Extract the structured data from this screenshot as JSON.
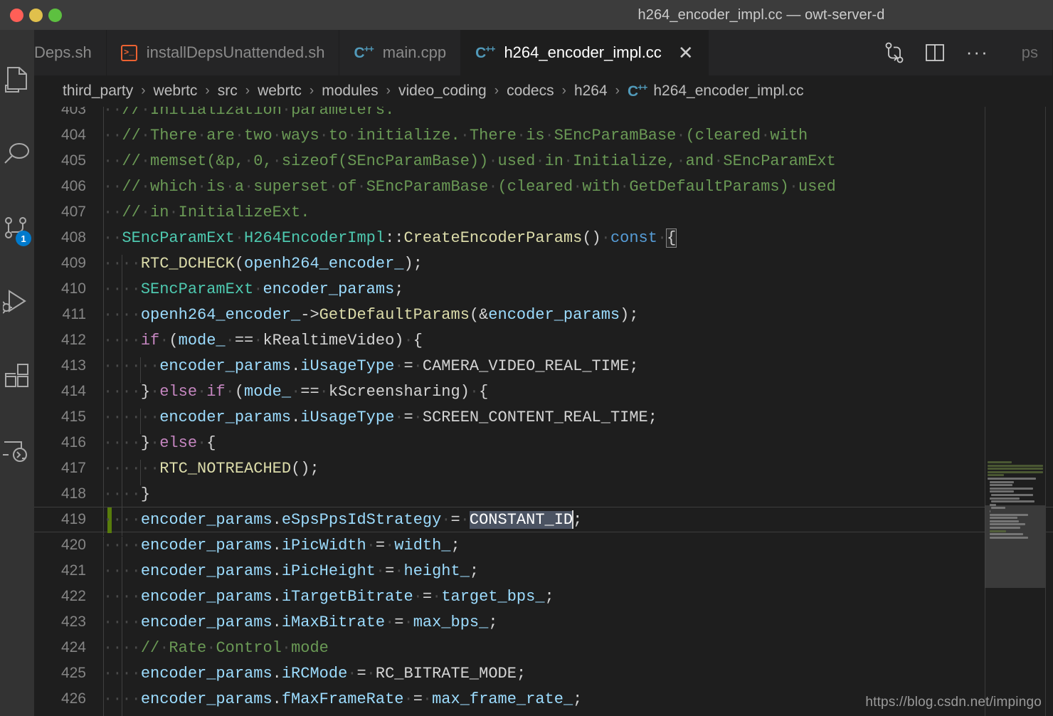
{
  "window": {
    "title": "h264_encoder_impl.cc — owt-server-d",
    "traffic_lights": [
      "close-red",
      "minimize-yellow",
      "maximize-green"
    ]
  },
  "activity_bar": {
    "items": [
      {
        "name": "explorer",
        "icon": "files-icon",
        "badge": ""
      },
      {
        "name": "search",
        "icon": "search-icon",
        "badge": ""
      },
      {
        "name": "source-control",
        "icon": "source-control-icon",
        "badge": "1"
      },
      {
        "name": "run-and-debug",
        "icon": "run-debug-icon",
        "badge": ""
      },
      {
        "name": "extensions",
        "icon": "extensions-icon",
        "badge": ""
      },
      {
        "name": "remote-explorer",
        "icon": "remote-terminal-icon",
        "badge": ""
      }
    ]
  },
  "tabs": [
    {
      "label": "Deps.sh",
      "icon": "shell-icon",
      "active": false,
      "truncated": true
    },
    {
      "label": "installDepsUnattended.sh",
      "icon": "shell-icon",
      "active": false
    },
    {
      "label": "main.cpp",
      "icon": "cpp-icon",
      "active": false
    },
    {
      "label": "h264_encoder_impl.cc",
      "icon": "cpp-icon",
      "active": true,
      "close": "✕"
    },
    {
      "label": "ps",
      "icon": "none",
      "active": false,
      "partial": true
    }
  ],
  "tab_actions": [
    {
      "name": "compare-changes-icon",
      "label": ""
    },
    {
      "name": "split-editor-icon",
      "label": ""
    },
    {
      "name": "more-actions-icon",
      "label": "···"
    }
  ],
  "breadcrumb": {
    "separator": "›",
    "items": [
      "third_party",
      "webrtc",
      "src",
      "webrtc",
      "modules",
      "video_coding",
      "codecs",
      "h264"
    ],
    "file": "h264_encoder_impl.cc",
    "file_icon": "cpp-icon"
  },
  "editor": {
    "language": "cpp",
    "cursor_line": 419,
    "selection_text": "CONSTANT_ID",
    "first_visible_line": 403,
    "last_visible_line": 426,
    "lines": [
      {
        "n": 403,
        "text": "  // Initialization parameters."
      },
      {
        "n": 404,
        "text": "  // There are two ways to initialize. There is SEncParamBase (cleared with"
      },
      {
        "n": 405,
        "text": "  // memset(&p, 0, sizeof(SEncParamBase)) used in Initialize, and SEncParamExt"
      },
      {
        "n": 406,
        "text": "  // which is a superset of SEncParamBase (cleared with GetDefaultParams) used"
      },
      {
        "n": 407,
        "text": "  // in InitializeExt."
      },
      {
        "n": 408,
        "text": "  SEncParamExt H264EncoderImpl::CreateEncoderParams() const {"
      },
      {
        "n": 409,
        "text": "    RTC_DCHECK(openh264_encoder_);"
      },
      {
        "n": 410,
        "text": "    SEncParamExt encoder_params;"
      },
      {
        "n": 411,
        "text": "    openh264_encoder_->GetDefaultParams(&encoder_params);"
      },
      {
        "n": 412,
        "text": "    if (mode_ == kRealtimeVideo) {"
      },
      {
        "n": 413,
        "text": "      encoder_params.iUsageType = CAMERA_VIDEO_REAL_TIME;"
      },
      {
        "n": 414,
        "text": "    } else if (mode_ == kScreensharing) {"
      },
      {
        "n": 415,
        "text": "      encoder_params.iUsageType = SCREEN_CONTENT_REAL_TIME;"
      },
      {
        "n": 416,
        "text": "    } else {"
      },
      {
        "n": 417,
        "text": "      RTC_NOTREACHED();"
      },
      {
        "n": 418,
        "text": "    }"
      },
      {
        "n": 419,
        "text": "    encoder_params.eSpsPpsIdStrategy = CONSTANT_ID;"
      },
      {
        "n": 420,
        "text": "    encoder_params.iPicWidth = width_;"
      },
      {
        "n": 421,
        "text": "    encoder_params.iPicHeight = height_;"
      },
      {
        "n": 422,
        "text": "    encoder_params.iTargetBitrate = target_bps_;"
      },
      {
        "n": 423,
        "text": "    encoder_params.iMaxBitrate = max_bps_;"
      },
      {
        "n": 424,
        "text": "    // Rate Control mode"
      },
      {
        "n": 425,
        "text": "    encoder_params.iRCMode = RC_BITRATE_MODE;"
      },
      {
        "n": 426,
        "text": "    encoder_params.fMaxFrameRate = max_frame_rate_;"
      }
    ]
  },
  "watermark": {
    "text": "https://blog.csdn.net/impingo"
  },
  "colors": {
    "background": "#1e1e1e",
    "titlebar": "#3c3c3c",
    "activitybar": "#333333",
    "tabbar": "#252526",
    "comment": "#6a9955",
    "type": "#4ec9b0",
    "function": "#dcdcaa",
    "keyword": "#569cd6",
    "control": "#c586c0",
    "variable": "#9cdcfe",
    "plain": "#d4d4d4",
    "line_number": "#858585",
    "git_added": "#587c0c",
    "badge": "#007acc",
    "cpp_icon": "#519aba",
    "shell_icon": "#ec6231",
    "selection": "#4b5362"
  }
}
